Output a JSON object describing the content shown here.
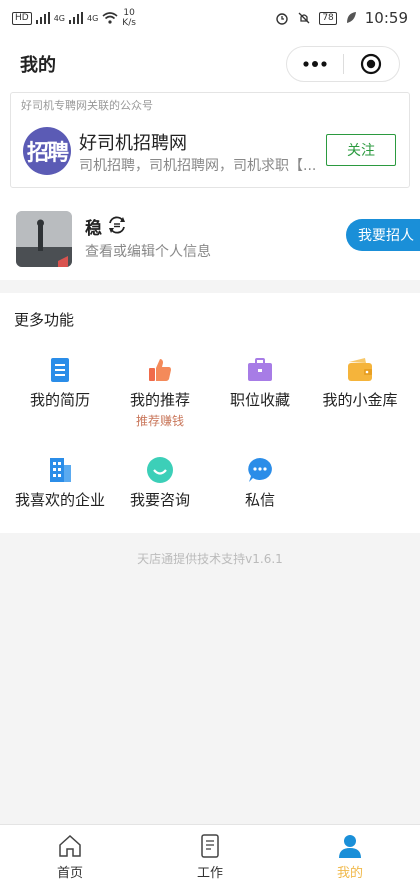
{
  "status_bar": {
    "left_badges": [
      "HD",
      "4G",
      "4G"
    ],
    "speed_value": "10",
    "speed_unit": "K/s",
    "battery": "78",
    "time": "10:59"
  },
  "nav": {
    "title": "我的"
  },
  "official_account": {
    "caption": "好司机专聘网关联的公众号",
    "logo_text": "招聘",
    "name": "好司机招聘网",
    "description": "司机招聘，司机招聘网，司机求职【...",
    "follow_label": "关注"
  },
  "profile": {
    "name": "稳",
    "edit_hint": "查看或编辑个人信息",
    "recruit_label": "我要招人"
  },
  "more_features": {
    "title": "更多功能",
    "items": [
      {
        "label": "我的简历",
        "icon": "resume-icon",
        "color": "#2b8de8"
      },
      {
        "label": "我的推荐",
        "sub": "推荐赚钱",
        "icon": "thumbs-up-icon",
        "color": "#f06b4a"
      },
      {
        "label": "职位收藏",
        "icon": "briefcase-icon",
        "color": "#a77ce6"
      },
      {
        "label": "我的小金库",
        "icon": "wallet-icon",
        "color": "#f5b43b"
      },
      {
        "label": "我喜欢的企业",
        "icon": "building-icon",
        "color": "#2b8de8"
      },
      {
        "label": "我要咨询",
        "icon": "smile-chat-icon",
        "color": "#3ccfb8"
      },
      {
        "label": "私信",
        "icon": "message-bubble-icon",
        "color": "#2b8de8"
      }
    ]
  },
  "footer_credit": "天店通提供技术支持v1.6.1",
  "tabs": [
    {
      "label": "首页",
      "icon": "home-icon",
      "active": false
    },
    {
      "label": "工作",
      "icon": "document-icon",
      "active": false
    },
    {
      "label": "我的",
      "icon": "person-icon",
      "active": true
    }
  ],
  "colors": {
    "accent_green": "#2b9a3f",
    "accent_blue": "#1a8fd8",
    "active_tab": "#f0b94b"
  }
}
